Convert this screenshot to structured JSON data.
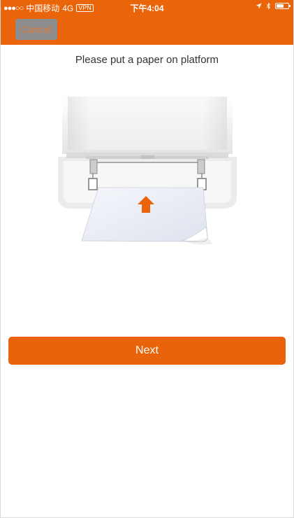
{
  "status_bar": {
    "signal": "●●●○○",
    "carrier": "中国移动",
    "network": "4G",
    "vpn": "VPN",
    "time": "下午4:04",
    "battery_level": 0.55
  },
  "header": {
    "cancel_label": "Cancel",
    "background_color": "#ea6409"
  },
  "main": {
    "instruction": "Please put a paper on platform",
    "illustration_icons": [
      "printer-icon",
      "paper-icon",
      "up-arrow-icon"
    ]
  },
  "footer": {
    "next_label": "Next",
    "accent_color": "#e9630a"
  }
}
